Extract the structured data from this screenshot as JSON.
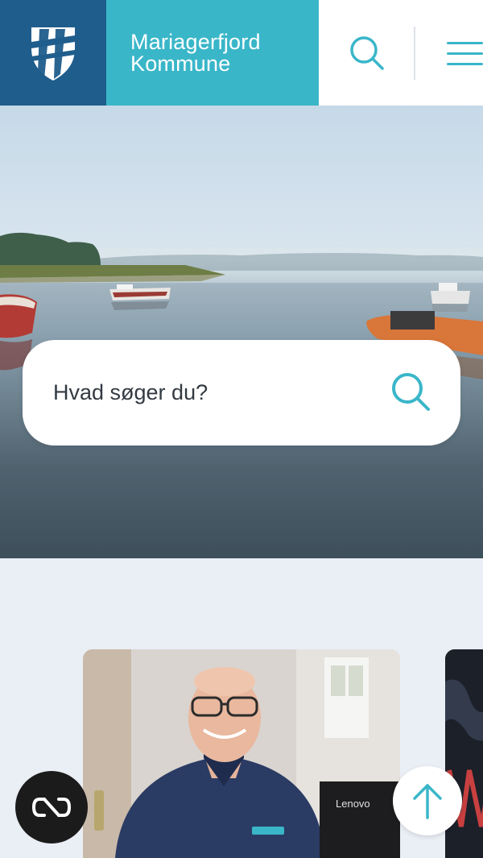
{
  "header": {
    "brand_line1": "Mariagerfjord",
    "brand_line2": "Kommune",
    "logo_icon": "municipality-shield-logo",
    "search_icon": "search-icon",
    "menu_icon": "hamburger-menu-icon"
  },
  "hero": {
    "image": "fjord-with-rowing-boats",
    "search_placeholder": "Hvad søger du?",
    "search_icon": "search-icon"
  },
  "cards": [
    {
      "image": "smiling-staff-member-at-desk",
      "computer_brand": "Lenovo"
    },
    {
      "image": "dark-event-poster"
    }
  ],
  "floating": {
    "accessibility_icon": "accessibility-toggle-icon",
    "scroll_top_icon": "arrow-up-icon"
  },
  "colors": {
    "primary_blue": "#1f5d8c",
    "accent_teal": "#3ab6c9",
    "page_background": "#eaeef5"
  }
}
